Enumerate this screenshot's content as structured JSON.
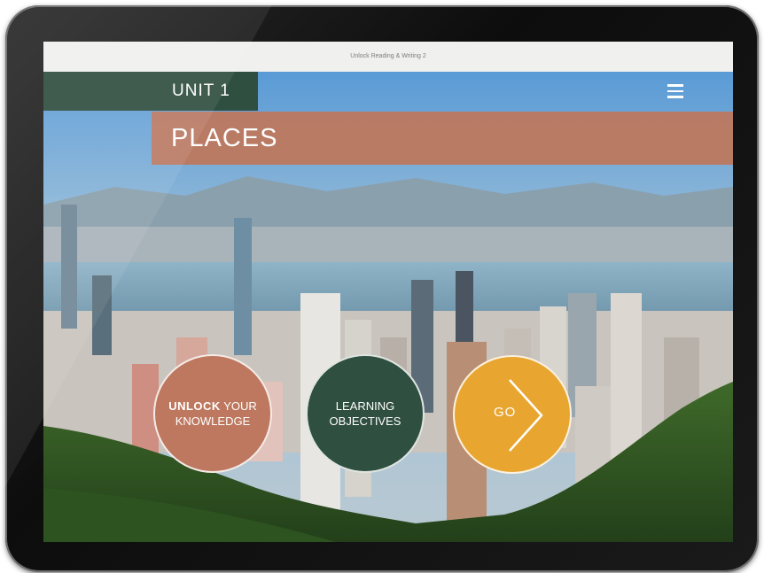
{
  "status_bar": {
    "title": "Unlock Reading & Writing 2"
  },
  "header": {
    "unit_label": "UNIT 1",
    "menu_icon": "hamburger-menu-icon"
  },
  "banner": {
    "title": "PLACES"
  },
  "buttons": {
    "unlock": {
      "bold_part": "UNLOCK",
      "rest": "YOUR",
      "line2": "KNOWLEDGE",
      "color": "#bd785f"
    },
    "objectives": {
      "line1": "LEARNING",
      "line2": "OBJECTIVES",
      "color": "#2f4f40"
    },
    "go": {
      "label": "GO",
      "icon": "chevron-right-icon",
      "color": "#e8a631"
    }
  },
  "colors": {
    "unit_bar": "#2f4f40",
    "places_bar": "#be785f",
    "status_bar_bg": "#f0f0ee"
  }
}
